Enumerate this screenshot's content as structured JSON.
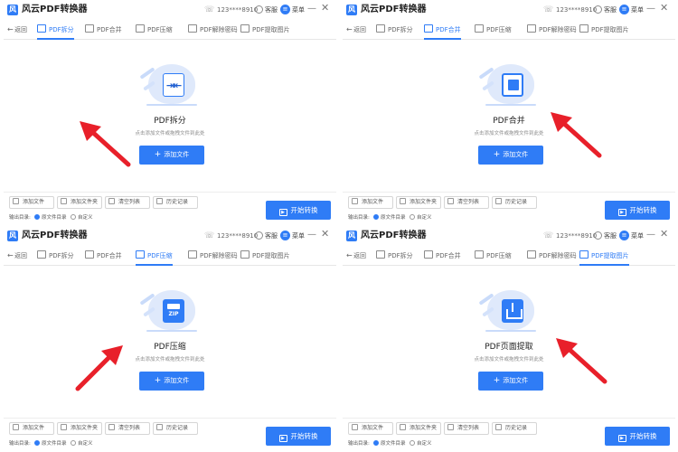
{
  "colors": {
    "accent": "#2f7cf6",
    "arrow": "#e8202a"
  },
  "app": {
    "title": "风云PDF转换器",
    "user": "123****8910",
    "vip": "客服",
    "menu": "菜单",
    "minimize": "—",
    "close": "✕"
  },
  "nav": {
    "back": "返回",
    "tabs": [
      "PDF拆分",
      "PDF合并",
      "PDF压缩",
      "PDF解除密码",
      "PDF提取图片"
    ]
  },
  "main": {
    "hint": "点击添加文件或拖拽文件到此处",
    "add_button": "添加文件"
  },
  "toolbar": {
    "buttons": [
      "添加文件",
      "添加文件夹",
      "清空列表",
      "历史记录"
    ],
    "output_label": "输出目录:",
    "radio_source": "原文件目录",
    "radio_custom": "自定义",
    "start_button": "开始转换"
  },
  "panels": [
    {
      "function_title": "PDF拆分",
      "active_tab": "PDF拆分",
      "icon": "split-icon"
    },
    {
      "function_title": "PDF合并",
      "active_tab": "PDF合并",
      "icon": "merge-icon"
    },
    {
      "function_title": "PDF压缩",
      "active_tab": "PDF压缩",
      "icon": "zip-icon"
    },
    {
      "function_title": "PDF页面提取",
      "active_tab": "PDF提取图片",
      "icon": "extract-icon"
    }
  ]
}
